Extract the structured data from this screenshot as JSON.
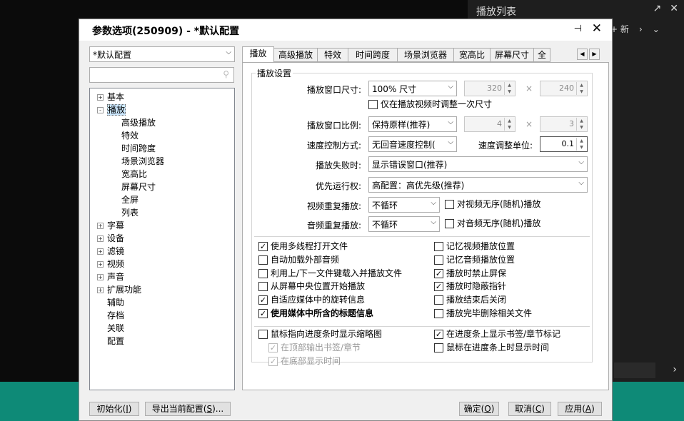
{
  "playlist": {
    "title": "播放列表",
    "new_label": "新",
    "icons": {
      "maximize": "arrow-expand-icon",
      "close": "close-icon",
      "next": "chevron-right-icon",
      "menu": "chevron-down-icon"
    }
  },
  "dialog": {
    "title": "参数选项(250909) - *默认配置",
    "profile": "*默认配置",
    "search_placeholder": "",
    "tree": [
      {
        "label": "基本",
        "exp": "+"
      },
      {
        "label": "播放",
        "exp": "-"
      },
      {
        "label": "高级播放"
      },
      {
        "label": "特效"
      },
      {
        "label": "时间跨度"
      },
      {
        "label": "场景浏览器"
      },
      {
        "label": "宽高比"
      },
      {
        "label": "屏幕尺寸"
      },
      {
        "label": "全屏"
      },
      {
        "label": "列表"
      },
      {
        "label": "字幕",
        "exp": "+"
      },
      {
        "label": "设备",
        "exp": "+"
      },
      {
        "label": "滤镜",
        "exp": "+"
      },
      {
        "label": "视频",
        "exp": "+"
      },
      {
        "label": "声音",
        "exp": "+"
      },
      {
        "label": "扩展功能",
        "exp": "+"
      },
      {
        "label": "辅助"
      },
      {
        "label": "存档"
      },
      {
        "label": "关联"
      },
      {
        "label": "配置"
      }
    ],
    "tabs": [
      "播放",
      "高级播放",
      "特效",
      "时间跨度",
      "场景浏览器",
      "宽高比",
      "屏幕尺寸",
      "全"
    ],
    "group_title": "播放设置",
    "window_size": {
      "label": "播放窗口尺寸:",
      "value": "100% 尺寸",
      "w": "320",
      "h": "240",
      "times": "×",
      "once": "仅在播放视频时调整一次尺寸"
    },
    "aspect": {
      "label": "播放窗口比例:",
      "value": "保持原样(推荐)",
      "a": "4",
      "b": "3",
      "times": "×"
    },
    "speed": {
      "label": "速度控制方式:",
      "value": "无回音速度控制(",
      "unit_label": "速度调整单位:",
      "unit_value": "0.1"
    },
    "fail": {
      "label": "播放失败时:",
      "value": "显示错误窗口(推荐)"
    },
    "priority": {
      "label": "优先运行权:",
      "value": "高配置：高优先级(推荐)"
    },
    "video_repeat": {
      "label": "视频重复播放:",
      "value": "不循环",
      "random": "对视频无序(随机)播放"
    },
    "audio_repeat": {
      "label": "音频重复播放:",
      "value": "不循环",
      "random": "对音频无序(随机)播放"
    },
    "options_left": [
      {
        "label": "使用多线程打开文件",
        "checked": true
      },
      {
        "label": "自动加载外部音频",
        "checked": false
      },
      {
        "label": "利用上/下一文件键载入并播放文件",
        "checked": false
      },
      {
        "label": "从屏幕中央位置开始播放",
        "checked": false
      },
      {
        "label": "自适应媒体中的旋转信息",
        "checked": true
      },
      {
        "label": "使用媒体中所含的标题信息",
        "checked": true,
        "bold": true
      }
    ],
    "options_right": [
      {
        "label": "记忆视频播放位置",
        "checked": false
      },
      {
        "label": "记忆音频播放位置",
        "checked": false
      },
      {
        "label": "播放时禁止屏保",
        "checked": true
      },
      {
        "label": "播放时隐蔽指针",
        "checked": true
      },
      {
        "label": "播放结束后关闭",
        "checked": false
      },
      {
        "label": "播放完毕删除相关文件",
        "checked": false
      }
    ],
    "thumb_left": [
      {
        "label": "鼠标指向进度条时显示缩略图",
        "checked": false
      },
      {
        "label": "在顶部输出书签/章节",
        "checked": true,
        "disabled": true
      },
      {
        "label": "在底部显示时间",
        "checked": true,
        "disabled": true
      }
    ],
    "thumb_right": [
      {
        "label": "在进度条上显示书签/章节标记",
        "checked": true
      },
      {
        "label": "鼠标在进度条上时显示时间",
        "checked": false
      }
    ],
    "buttons": {
      "init": "初始化",
      "init_key": "I",
      "export": "导出当前配置",
      "export_key": "S",
      "ok": "确定",
      "ok_key": "O",
      "cancel": "取消",
      "cancel_key": "C",
      "apply": "应用",
      "apply_key": "A"
    }
  }
}
